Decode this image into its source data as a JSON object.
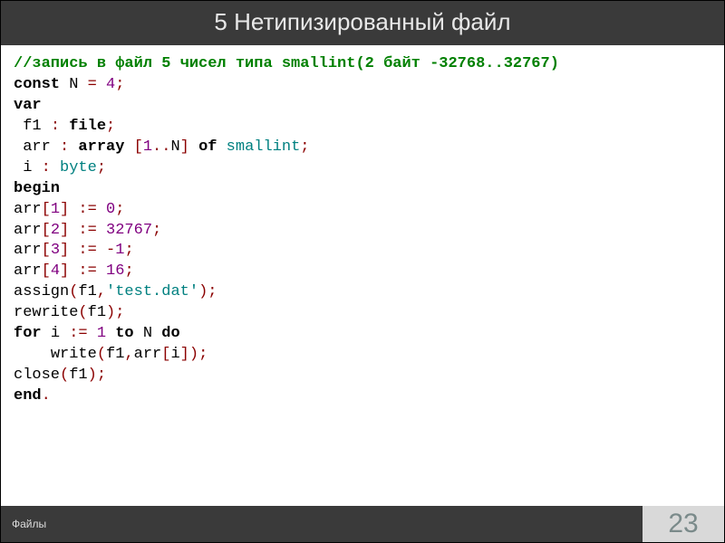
{
  "header": {
    "title": "5 Нетипизированный файл"
  },
  "footer": {
    "label": "Файлы",
    "page": "23"
  },
  "code": {
    "comment": "//запись в файл 5 чисел типа smallint(2 байт -32768..32767)",
    "l02": {
      "kw": "const",
      "id": "N",
      "eq": "=",
      "val": "4",
      "semi": ";"
    },
    "l03": {
      "kw": "var"
    },
    "l04": {
      "id": "f1",
      "colon": ":",
      "kw": "file",
      "semi": ";"
    },
    "l05": {
      "id": "arr",
      "colon": ":",
      "kw1": "array",
      "lb": "[",
      "n1": "1",
      "dd": "..",
      "n2": "N",
      "rb": "]",
      "kw2": "of",
      "type": "smallint",
      "semi": ";"
    },
    "l06": {
      "id": "i",
      "colon": ":",
      "type": "byte",
      "semi": ";"
    },
    "l07": {
      "kw": "begin"
    },
    "l08": {
      "id": "arr",
      "lb": "[",
      "idx": "1",
      "rb": "]",
      "asg": ":=",
      "val": "0",
      "semi": ";"
    },
    "l09": {
      "id": "arr",
      "lb": "[",
      "idx": "2",
      "rb": "]",
      "asg": ":=",
      "val": "32767",
      "semi": ";"
    },
    "l10": {
      "id": "arr",
      "lb": "[",
      "idx": "3",
      "rb": "]",
      "asg": ":=",
      "neg": "-",
      "val": "1",
      "semi": ";"
    },
    "l11": {
      "id": "arr",
      "lb": "[",
      "idx": "4",
      "rb": "]",
      "asg": ":=",
      "val": "16",
      "semi": ";"
    },
    "l12": {
      "fn": "assign",
      "lp": "(",
      "a1": "f1",
      "comma": ",",
      "str": "'test.dat'",
      "rp": ")",
      "semi": ";"
    },
    "l13": {
      "fn": "rewrite",
      "lp": "(",
      "a1": "f1",
      "rp": ")",
      "semi": ";"
    },
    "l14": {
      "kw1": "for",
      "id": "i",
      "asg": ":=",
      "n1": "1",
      "kw2": "to",
      "n2": "N",
      "kw3": "do"
    },
    "l15": {
      "fn": "write",
      "lp": "(",
      "a1": "f1",
      "comma": ",",
      "a2": "arr",
      "lb": "[",
      "idx": "i",
      "rb": "]",
      "rp": ")",
      "semi": ";"
    },
    "l16": {
      "fn": "close",
      "lp": "(",
      "a1": "f1",
      "rp": ")",
      "semi": ";"
    },
    "l17": {
      "kw": "end",
      "dot": "."
    }
  }
}
